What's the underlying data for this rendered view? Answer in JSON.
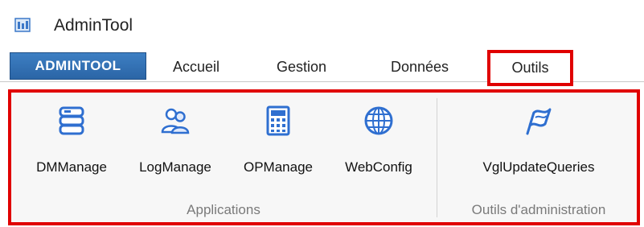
{
  "window": {
    "title": "AdminTool",
    "icon": "admintool-app-icon"
  },
  "ribbon_tabs": {
    "file_tab": "ADMINTOOL",
    "tabs": [
      "Accueil",
      "Gestion",
      "Données",
      "Outils"
    ],
    "active": "Outils"
  },
  "groups": [
    {
      "label": "Applications",
      "buttons": [
        {
          "label": "DMManage",
          "icon": "database-stack-icon"
        },
        {
          "label": "LogManage",
          "icon": "users-icon"
        },
        {
          "label": "OPManage",
          "icon": "calculator-icon"
        },
        {
          "label": "WebConfig",
          "icon": "globe-icon"
        }
      ]
    },
    {
      "label": "Outils d'administration",
      "buttons": [
        {
          "label": "VglUpdateQueries",
          "icon": "flag-icon"
        }
      ]
    }
  ],
  "colors": {
    "highlight_border": "#e00000",
    "file_tab_blue": "#2f6fb4",
    "icon_blue": "#2f6fd0"
  }
}
